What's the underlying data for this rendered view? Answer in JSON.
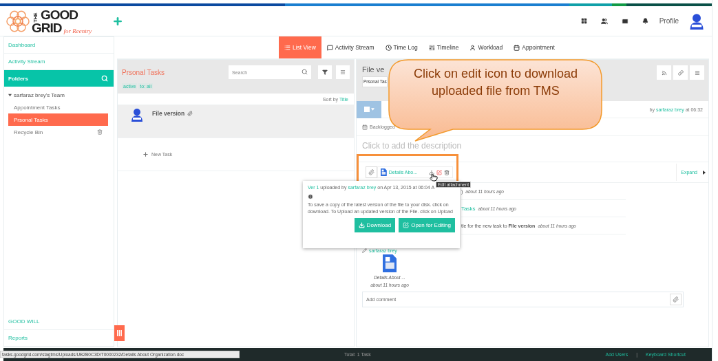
{
  "header": {
    "logo_the": "THE",
    "logo_top": "GOOD",
    "logo_bottom": "GRID",
    "logo_tagline": "for Reentry",
    "profile_label": "Profile"
  },
  "sidebar": {
    "top_items": [
      "Dashboard",
      "Activity Stream"
    ],
    "folders_label": "Folders",
    "team": {
      "label": "sarfaraz brey's Team",
      "expanded": true,
      "children": [
        {
          "label": "Appointment Tasks",
          "selected": false
        },
        {
          "label": "Prsonal Tasks",
          "selected": true
        },
        {
          "label": "Recycle Bin",
          "selected": false,
          "kind": "trash"
        }
      ]
    },
    "bottom_items": [
      "GOOD WILL",
      "Reports"
    ]
  },
  "view_tabs": [
    {
      "label": "List View",
      "selected": true
    },
    {
      "label": "Activity Stream",
      "selected": false
    },
    {
      "label": "Time Log",
      "selected": false
    },
    {
      "label": "Timeline",
      "selected": false
    },
    {
      "label": "Workload",
      "selected": false
    },
    {
      "label": "Appointment",
      "selected": false
    }
  ],
  "task_list": {
    "title": "Prsonal Tasks",
    "search_placeholder": "Search",
    "filters": [
      "active",
      "to: all"
    ],
    "sort_label": "Sort by",
    "sort_value": "Title",
    "tasks": [
      {
        "title": "File version",
        "selected": true
      }
    ],
    "new_task": "New Task"
  },
  "detail": {
    "title": "File ve",
    "folder": "Prsonal Tas",
    "by": "by",
    "author": "sarfaraz brey",
    "time": "at 06:32",
    "status": "Backlogged",
    "description_placeholder": "Click to add the description",
    "attachment": "Details Abo...",
    "expand": "Expand",
    "activities": [
      {
        "text": ")",
        "time": "about 11 hours ago"
      },
      {
        "link": "Tasks",
        "time": "about 11 hours ago"
      },
      {
        "text": "tle for the new task to **File version**",
        "time": "about 11 hours ago"
      }
    ],
    "file_card": {
      "author": "sarfaraz brey",
      "name": "Details About ...",
      "time": "about 11 hours ago"
    },
    "comment_placeholder": "Add comment"
  },
  "popover": {
    "version": "Ver 1",
    "uploaded_by": "uploaded by",
    "user": "sarfaraz brey",
    "date": "on Apr 13, 2015 at 06:04 A",
    "info": " To save a copy of the latest version of the file to your disk. click on download. To Upload an updated version of the File. click on Upload",
    "buttons": [
      "Download",
      "Open for Editing"
    ]
  },
  "tooltip": "Edit attachment",
  "callout": "Click on edit icon to download uploaded file from TMS",
  "footer": {
    "total": "Total: 1 Task",
    "links": [
      "Add Users",
      "Keyboard Shortcut"
    ],
    "separator": "|"
  },
  "status_url": "tasks.goodgrid.com/stagtms/Uploads/UB2B0C3D/T0000232/Details About Organization.doc"
}
